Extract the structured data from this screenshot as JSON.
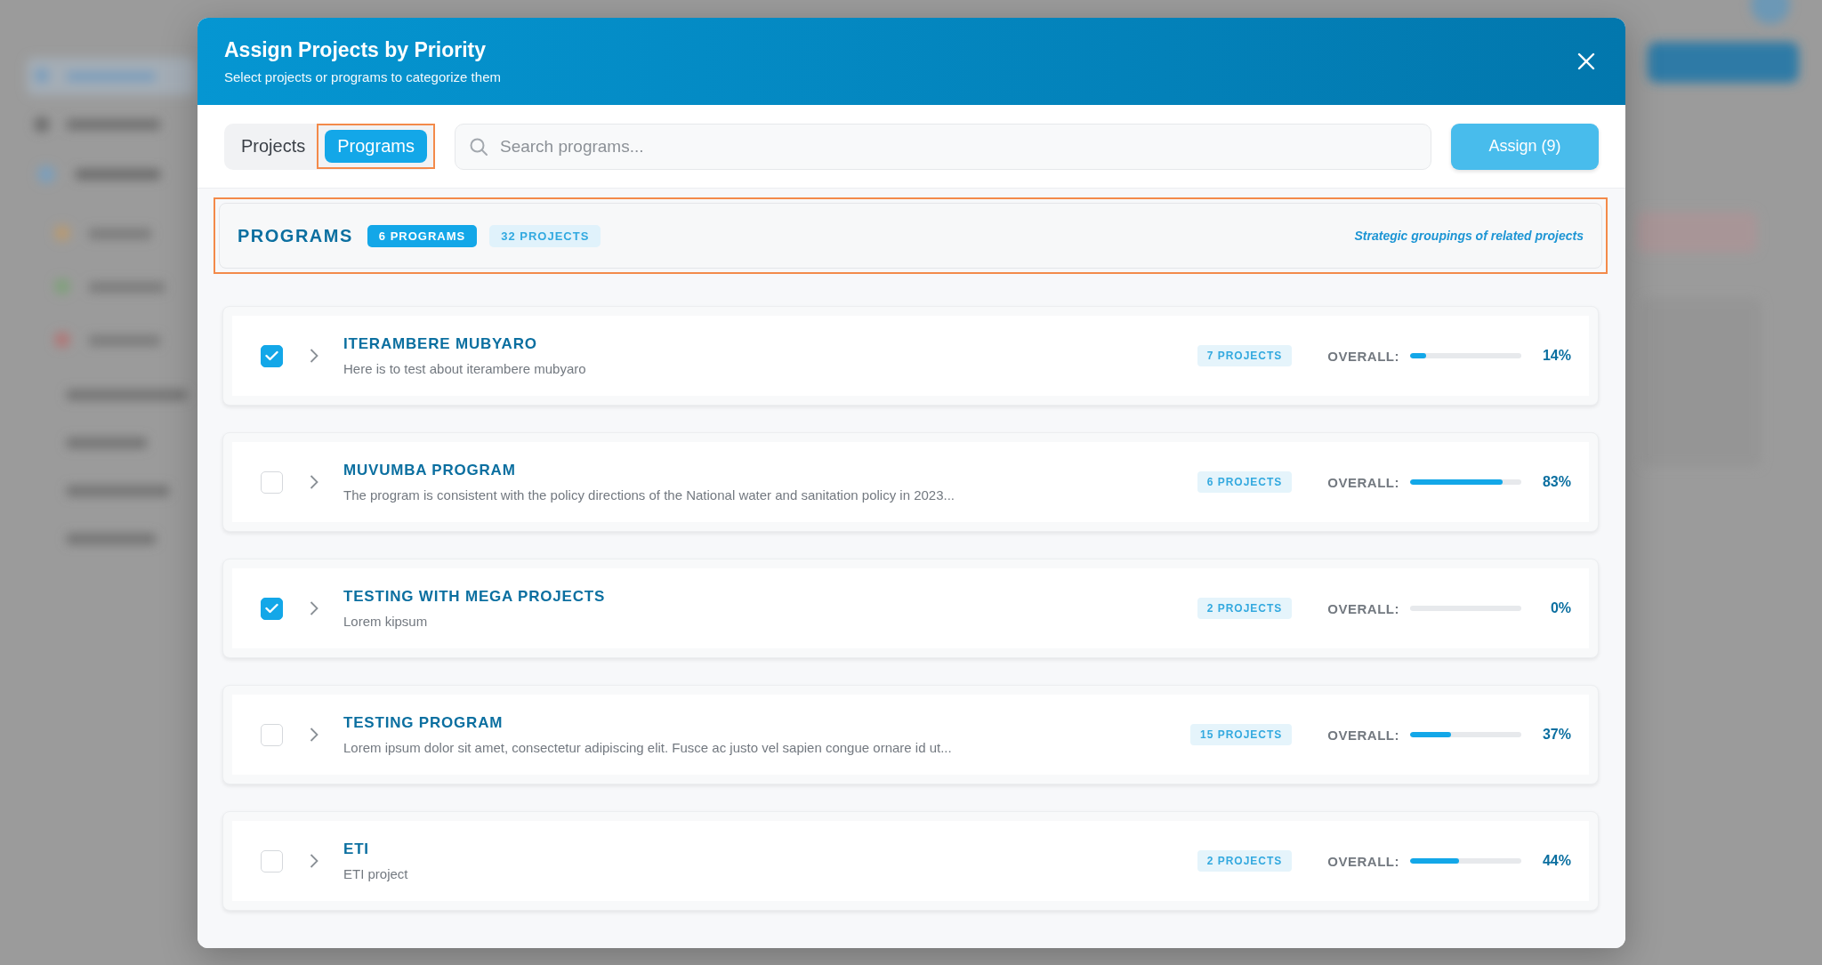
{
  "dialog": {
    "title": "Assign Projects by Priority",
    "subtitle": "Select projects or programs to categorize them"
  },
  "tabs": [
    {
      "label": "Projects",
      "selected": false,
      "highlighted": false
    },
    {
      "label": "Programs",
      "selected": true,
      "highlighted": true
    }
  ],
  "search": {
    "placeholder": "Search programs..."
  },
  "assign_button": {
    "label": "Assign (9)"
  },
  "section": {
    "title": "PROGRAMS",
    "highlighted": true,
    "badges": [
      {
        "label": "6 PROGRAMS",
        "kind": "solid"
      },
      {
        "label": "32 PROJECTS",
        "kind": "soft"
      }
    ],
    "note": "Strategic groupings of related projects"
  },
  "programs": [
    {
      "name": "ITERAMBERE MUBYARO",
      "description": "Here is to test about iterambere mubyaro",
      "checked": true,
      "expanded": false,
      "projects": "7 PROJECTS",
      "overall_label": "OVERALL:",
      "level": 0.14,
      "percent": "14%"
    },
    {
      "name": "MUVUMBA PROGRAM",
      "description": "The program is consistent with the policy directions of the National water and sanitation policy in 2023...",
      "checked": false,
      "expanded": false,
      "projects": "6 PROJECTS",
      "overall_label": "OVERALL:",
      "level": 0.83,
      "percent": "83%"
    },
    {
      "name": "TESTING WITH MEGA PROJECTS",
      "description": "Lorem kipsum",
      "checked": true,
      "expanded": false,
      "projects": "2 PROJECTS",
      "overall_label": "OVERALL:",
      "level": 0,
      "percent": "0%"
    },
    {
      "name": "TESTING PROGRAM",
      "description": "Lorem ipsum dolor sit amet, consectetur adipiscing elit. Fusce ac justo vel sapien congue ornare id ut...",
      "checked": false,
      "expanded": false,
      "projects": "15 PROJECTS",
      "overall_label": "OVERALL:",
      "level": 0.37,
      "percent": "37%"
    },
    {
      "name": "ETI",
      "description": "ETI project",
      "checked": false,
      "expanded": false,
      "projects": "2 PROJECTS",
      "overall_label": "OVERALL:",
      "level": 0.44,
      "percent": "44%"
    }
  ]
}
